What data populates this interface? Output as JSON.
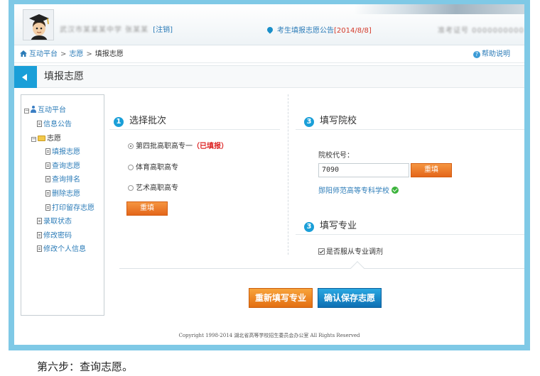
{
  "header": {
    "user_blurred": "武汉市某某某中学 张某某",
    "logout": "[注销]",
    "notice_text": "考生填报志愿公告",
    "notice_date": "[2014/8/8]",
    "exam_no_blurred": "准考证号 0000000000"
  },
  "breadcrumb": {
    "home": "互动平台",
    "sep": ">",
    "level2": "志愿",
    "current": "填报志愿",
    "help": "帮助说明"
  },
  "title": "填报志愿",
  "tree": {
    "root": "互动平台",
    "notice": "信息公告",
    "folder": "志愿",
    "fill": "填报志愿",
    "query": "查询志愿",
    "rank": "查询排名",
    "delete": "删除志愿",
    "print": "打印留存志愿",
    "admit": "录取状态",
    "pwd": "修改密码",
    "info": "修改个人信息"
  },
  "step1": {
    "num": "1",
    "title": "选择批次",
    "options": [
      {
        "label": "第四批高职高专一",
        "badge": "（已填报）",
        "selected": true
      },
      {
        "label": "体育高职高专",
        "badge": "",
        "selected": false
      },
      {
        "label": "艺术高职高专",
        "badge": "",
        "selected": false
      }
    ],
    "reset": "重填"
  },
  "step2": {
    "num": "3",
    "title": "填写院校",
    "code_label": "院校代号：",
    "code_value": "7090",
    "reset": "重填",
    "school_name": "郧阳师范高等专科学校"
  },
  "step3": {
    "num": "3",
    "title": "填写专业",
    "obey_label": "是否服从专业调剂",
    "obey_checked": true
  },
  "actions": {
    "refill": "重新填写专业",
    "confirm": "确认保存志愿"
  },
  "copyright": "Copyright 1998-2014 湖北省高等学校招生委员会办公室 All Rights Reserved",
  "caption": "第六步：查询志愿。",
  "colors": {
    "accent": "#1a9fd8",
    "orange": "#e4661a",
    "link": "#2c7cb8",
    "frame": "#7fc9e6"
  }
}
